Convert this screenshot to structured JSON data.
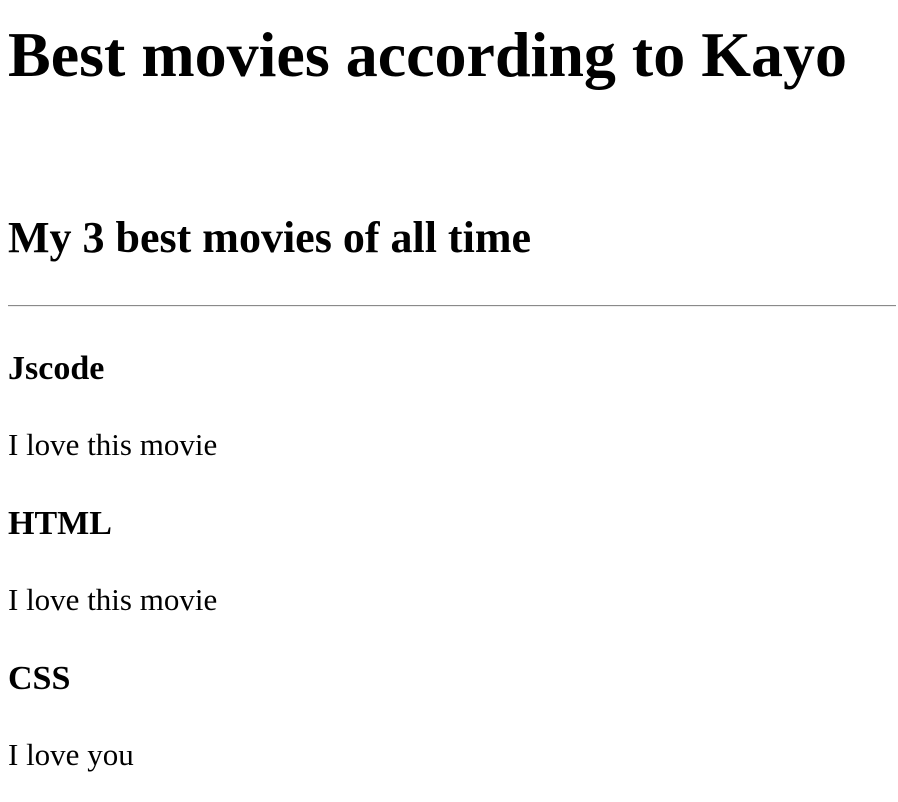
{
  "page": {
    "title": "Best movies according to Kayo",
    "subtitle": "My 3 best movies of all time"
  },
  "movies": [
    {
      "name": "Jscode",
      "description": "I love this movie"
    },
    {
      "name": "HTML",
      "description": "I love this movie"
    },
    {
      "name": "CSS",
      "description": "I love you"
    }
  ]
}
